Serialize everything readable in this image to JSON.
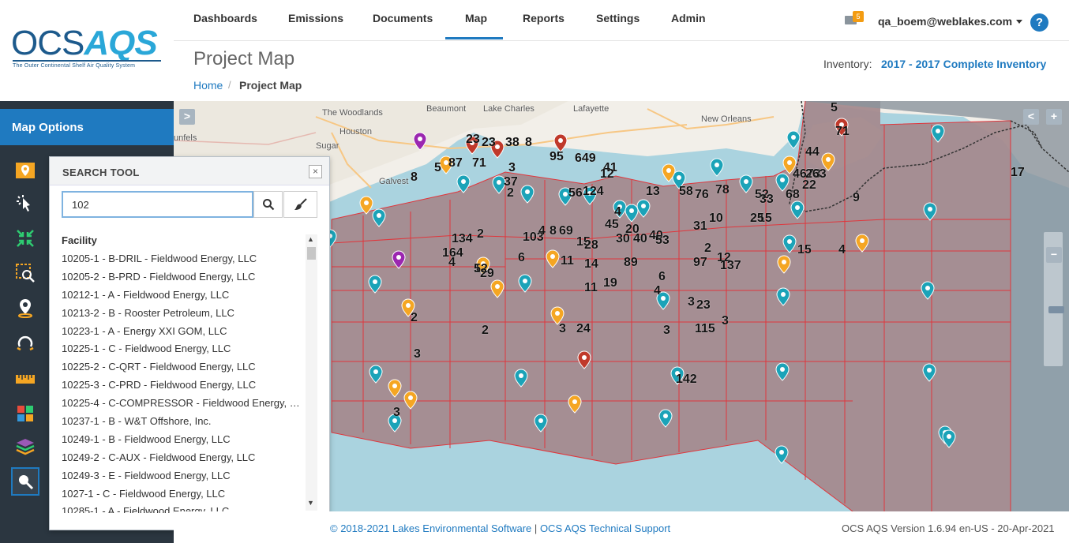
{
  "brand": {
    "logo_ocs": "OCS",
    "logo_aqs": "AQS",
    "tagline": "The Outer Continental Shelf Air Quality System"
  },
  "nav": {
    "items": [
      "Dashboards",
      "Emissions",
      "Documents",
      "Map",
      "Reports",
      "Settings",
      "Admin"
    ],
    "active": "Map",
    "notification_count": "5",
    "user_email": "qa_boem@weblakes.com",
    "help": "?"
  },
  "page": {
    "title": "Project Map",
    "breadcrumb_home": "Home",
    "breadcrumb_sep": "/",
    "breadcrumb_current": "Project Map",
    "inventory_label": "Inventory:",
    "inventory_value": "2017 - 2017 Complete Inventory"
  },
  "sidebar": {
    "title": "Map Options",
    "tools": [
      "facility-map-icon",
      "select-pointer-icon",
      "collapse-arrows-icon",
      "zoom-select-icon",
      "location-pin-icon",
      "radius-icon",
      "ruler-icon",
      "legend-grid-icon",
      "layers-icon",
      "search-icon"
    ]
  },
  "map": {
    "labels": {
      "beaumont": "Beaumont",
      "lake_charles": "Lake Charles",
      "lafayette": "Lafayette",
      "woodlands": "The Woodlands",
      "houston": "Houston",
      "sugar": "Sugar",
      "galveston": "Galvest",
      "new_orleans": "New Orleans",
      "unfels": "unfels"
    },
    "controls": {
      "expand": ">",
      "collapse": "<",
      "zoom_in": "+",
      "zoom_out": "−"
    },
    "cluster_counts": [
      "5",
      "71",
      "23",
      "23",
      "38",
      "8",
      "95",
      "649",
      "41",
      "12",
      "87",
      "71",
      "3",
      "37",
      "2",
      "5",
      "8",
      "44",
      "4673",
      "263",
      "22",
      "17",
      "56",
      "124",
      "4",
      "45",
      "13",
      "58",
      "76",
      "78",
      "52",
      "68",
      "9",
      "33",
      "15",
      "134",
      "2",
      "103",
      "4",
      "8",
      "69",
      "15",
      "28",
      "30",
      "20",
      "40",
      "40",
      "53",
      "31",
      "10",
      "25",
      "15",
      "4",
      "164",
      "4",
      "12",
      "6",
      "11",
      "14",
      "89",
      "97",
      "2",
      "12",
      "137",
      "5",
      "29",
      "19",
      "11",
      "6",
      "4",
      "3",
      "23",
      "3",
      "115",
      "3",
      "3",
      "24",
      "2",
      "142",
      "2",
      "3",
      "3",
      "2"
    ]
  },
  "search_tool": {
    "title": "SEARCH TOOL",
    "close": "×",
    "query": "102",
    "list_header": "Facility",
    "results": [
      "10205-1 - B-DRIL - Fieldwood Energy, LLC",
      "10205-2 - B-PRD - Fieldwood Energy, LLC",
      "10212-1 - A - Fieldwood Energy, LLC",
      "10213-2 - B - Rooster Petroleum, LLC",
      "10223-1 - A - Energy XXI GOM, LLC",
      "10225-1 - C - Fieldwood Energy, LLC",
      "10225-2 - C-QRT - Fieldwood Energy, LLC",
      "10225-3 - C-PRD - Fieldwood Energy, LLC",
      "10225-4 - C-COMPRESSOR - Fieldwood Energy, LLC",
      "10237-1 - B - W&T Offshore, Inc.",
      "10249-1 - B - Fieldwood Energy, LLC",
      "10249-2 - C-AUX - Fieldwood Energy, LLC",
      "10249-3 - E - Fieldwood Energy, LLC",
      "1027-1 - C - Fieldwood Energy, LLC",
      "10285-1 - A - Fieldwood Energy, LLC"
    ]
  },
  "footer": {
    "copyright": "© 2018-2021 Lakes Environmental Software",
    "sep": "|",
    "support_link": "OCS AQS Technical Support",
    "version": "OCS AQS Version 1.6.94 en-US - 20-Apr-2021"
  },
  "colors": {
    "accent": "#1f7ac0",
    "sidebar_bg": "#2b3640",
    "lease_fill": "#a48a8e",
    "lease_border": "#e0363c",
    "water": "#aad3df",
    "marker_orange": "#f5a623",
    "marker_red": "#c0392b",
    "marker_teal": "#1ba3b8",
    "marker_purple": "#9b27b0"
  }
}
